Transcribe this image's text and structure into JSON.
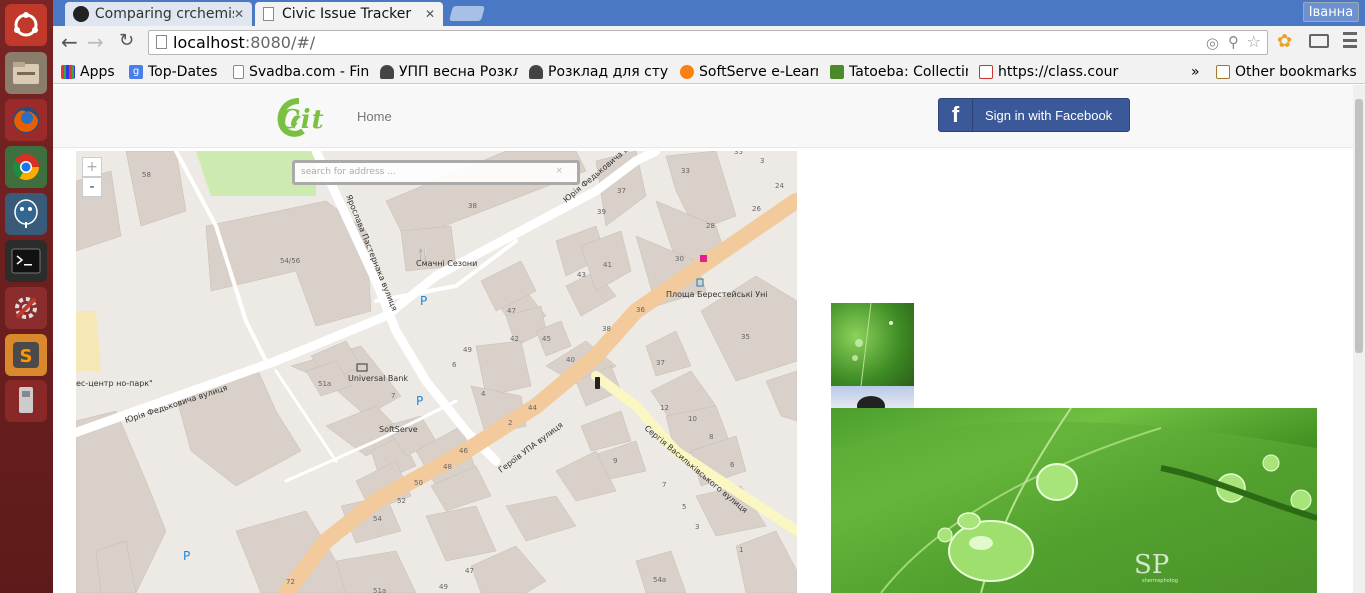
{
  "browser": {
    "tabs": [
      {
        "label": "Comparing crchemis",
        "active": false
      },
      {
        "label": "Civic Issue Tracker",
        "active": true
      }
    ],
    "user": "Іванна",
    "url_host": "localhost",
    "url_rest": ":8080/#/"
  },
  "bookmarks": {
    "items": [
      {
        "label": "Apps"
      },
      {
        "label": "Top-Dates"
      },
      {
        "label": "Svadba.com - Fin"
      },
      {
        "label": "УПП весна Розкл"
      },
      {
        "label": "Розклад для студ"
      },
      {
        "label": "SoftServe e-Learn"
      },
      {
        "label": "Tatoeba: Collectin"
      },
      {
        "label": "https://class.cour"
      }
    ],
    "overflow": "»",
    "other": "Other bookmarks"
  },
  "app": {
    "logo_text": "Cit",
    "nav_home": "Home",
    "facebook_button": "Sign in with Facebook"
  },
  "map": {
    "search_placeholder": "search for address ...",
    "search_clear": "×",
    "zoom_in": "+",
    "zoom_out": "-",
    "streets": [
      "Юрія Федьковича вулиця",
      "Ярослава Пастернака вулиця",
      "Героїв УПА вулиця",
      "Сергія Васильківського вулиця",
      "Юрія Федьковича вулиця"
    ],
    "pois": [
      {
        "label": "Смачні Сезони"
      },
      {
        "label": "Universal Bank"
      },
      {
        "label": "SoftServe"
      },
      {
        "label": "Площа Берестейські Уні"
      },
      {
        "label": "ес-центр но-парк\""
      }
    ],
    "building_numbers": [
      "58",
      "54/56",
      "38",
      "3",
      "35",
      "33",
      "37",
      "39",
      "24",
      "26",
      "28",
      "30",
      "43",
      "41",
      "47",
      "42",
      "45",
      "49",
      "6",
      "40",
      "38",
      "36",
      "35",
      "37",
      "51a",
      "7",
      "4",
      "2",
      "44",
      "12",
      "10",
      "8",
      "6",
      "46",
      "48",
      "50",
      "52",
      "54",
      "9",
      "7",
      "5",
      "3",
      "1",
      "47",
      "49",
      "72",
      "51a",
      "54a"
    ],
    "parking": "P"
  },
  "photo": {
    "watermark_big": "SP",
    "watermark_small": "shermsphotog"
  }
}
